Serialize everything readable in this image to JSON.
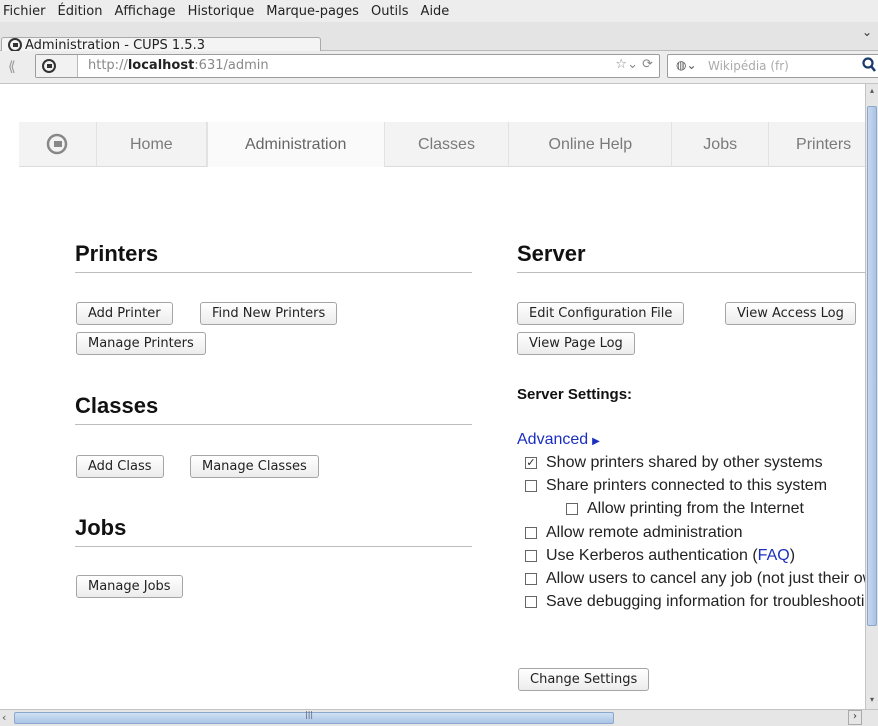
{
  "menu": [
    "Fichier",
    "Édition",
    "Affichage",
    "Historique",
    "Marque-pages",
    "Outils",
    "Aide"
  ],
  "tab": {
    "title": "Administration - CUPS 1.5.3"
  },
  "url": {
    "prefix": "http://",
    "host": "localhost",
    "suffix": ":631/admin"
  },
  "search": {
    "placeholder": "Wikipédia (fr)"
  },
  "cups_nav": [
    "Home",
    "Administration",
    "Classes",
    "Online Help",
    "Jobs",
    "Printers"
  ],
  "printers": {
    "heading": "Printers",
    "buttons": [
      "Add Printer",
      "Find New Printers",
      "Manage Printers"
    ]
  },
  "classes": {
    "heading": "Classes",
    "buttons": [
      "Add Class",
      "Manage Classes"
    ]
  },
  "jobs": {
    "heading": "Jobs",
    "buttons": [
      "Manage Jobs"
    ]
  },
  "server": {
    "heading": "Server",
    "buttons": [
      "Edit Configuration File",
      "View Access Log",
      "View Page Log"
    ],
    "settings_label": "Server Settings:",
    "advanced_link": "Advanced",
    "options": [
      {
        "label": "Show printers shared by other systems",
        "checked": true
      },
      {
        "label": "Share printers connected to this system",
        "checked": false
      },
      {
        "label": "Allow printing from the Internet",
        "checked": false
      },
      {
        "label": "Allow remote administration",
        "checked": false
      },
      {
        "label": "Use Kerberos authentication (",
        "link": "FAQ",
        "after": ")",
        "checked": false
      },
      {
        "label": "Allow users to cancel any job (not just their own)",
        "checked": false
      },
      {
        "label": "Save debugging information for troubleshooting",
        "checked": false
      }
    ],
    "change_button": "Change Settings"
  }
}
